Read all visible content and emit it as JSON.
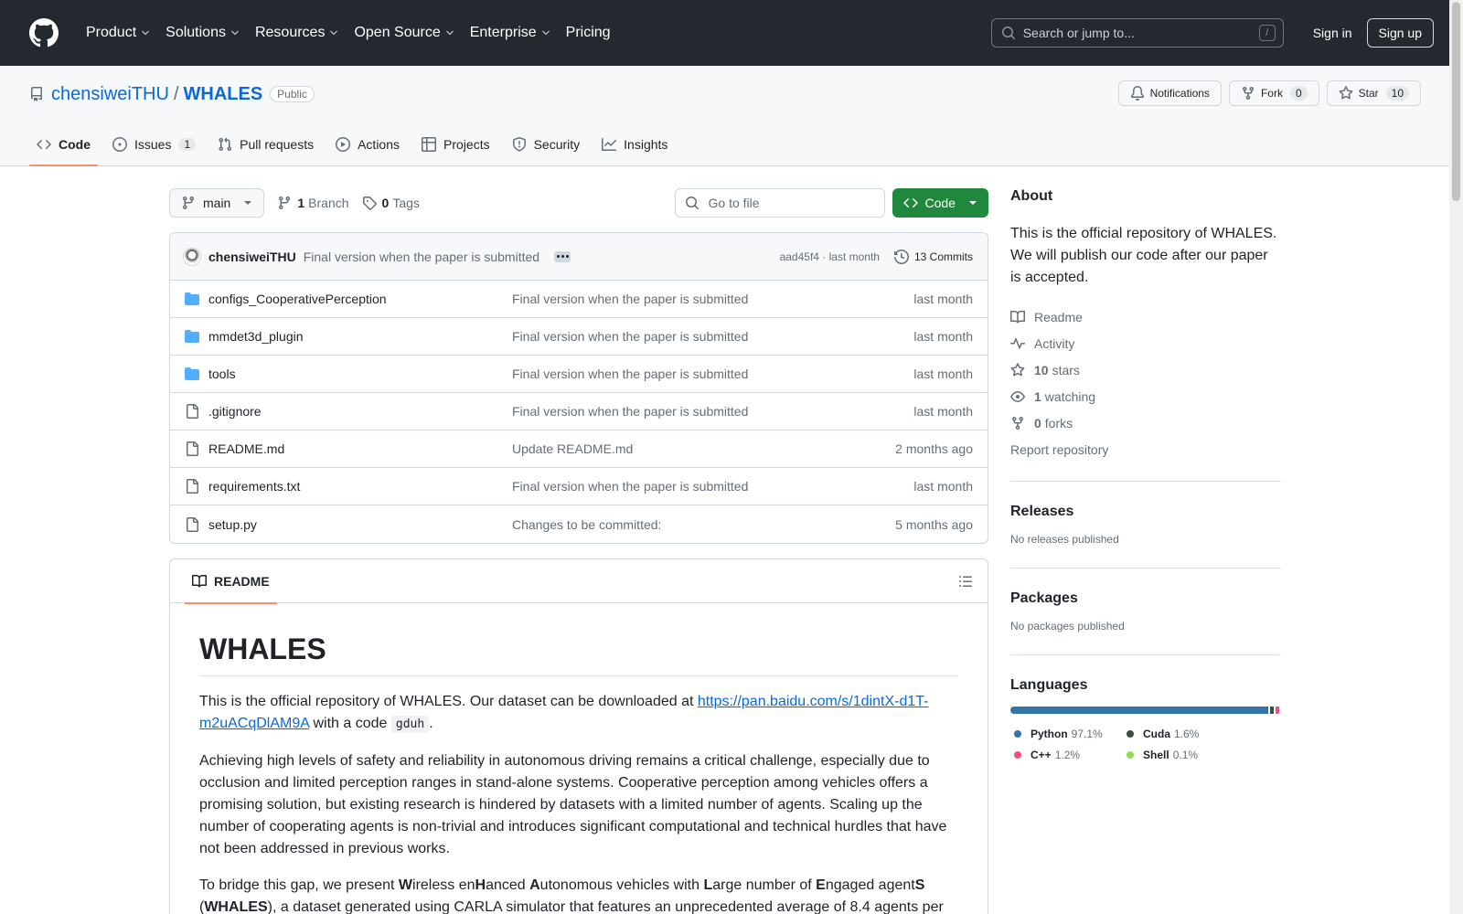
{
  "header": {
    "nav": [
      {
        "label": "Product",
        "dropdown": true
      },
      {
        "label": "Solutions",
        "dropdown": true
      },
      {
        "label": "Resources",
        "dropdown": true
      },
      {
        "label": "Open Source",
        "dropdown": true
      },
      {
        "label": "Enterprise",
        "dropdown": true
      },
      {
        "label": "Pricing",
        "dropdown": false
      }
    ],
    "search_placeholder": "Search or jump to...",
    "search_shortcut": "/",
    "signin_label": "Sign in",
    "signup_label": "Sign up"
  },
  "repo": {
    "owner": "chensiweiTHU",
    "separator": "/",
    "name": "WHALES",
    "visibility": "Public",
    "notifications_label": "Notifications",
    "fork_label": "Fork",
    "fork_count": "0",
    "star_label": "Star",
    "star_count": "10",
    "tabs": [
      {
        "label": "Code",
        "icon": "code-icon",
        "active": true,
        "count": ""
      },
      {
        "label": "Issues",
        "icon": "issue-icon",
        "active": false,
        "count": "1"
      },
      {
        "label": "Pull requests",
        "icon": "pull-request-icon",
        "active": false,
        "count": ""
      },
      {
        "label": "Actions",
        "icon": "play-icon",
        "active": false,
        "count": ""
      },
      {
        "label": "Projects",
        "icon": "table-icon",
        "active": false,
        "count": ""
      },
      {
        "label": "Security",
        "icon": "shield-icon",
        "active": false,
        "count": ""
      },
      {
        "label": "Insights",
        "icon": "graph-icon",
        "active": false,
        "count": ""
      }
    ]
  },
  "filebar": {
    "branch": "main",
    "branches_count": "1",
    "branches_label": "Branch",
    "tags_count": "0",
    "tags_label": "Tags",
    "goto_placeholder": "Go to file",
    "code_label": "Code"
  },
  "commit": {
    "author": "chensiweiTHU",
    "message": "Final version when the paper is submitted",
    "sha_time": "aad45f4 · last month",
    "commits_label": "13 Commits"
  },
  "files": [
    {
      "type": "folder",
      "name": "configs_CooperativePerception",
      "message": "Final version when the paper is submitted",
      "date": "last month"
    },
    {
      "type": "folder",
      "name": "mmdet3d_plugin",
      "message": "Final version when the paper is submitted",
      "date": "last month"
    },
    {
      "type": "folder",
      "name": "tools",
      "message": "Final version when the paper is submitted",
      "date": "last month"
    },
    {
      "type": "file",
      "name": ".gitignore",
      "message": "Final version when the paper is submitted",
      "date": "last month"
    },
    {
      "type": "file",
      "name": "README.md",
      "message": "Update README.md",
      "date": "2 months ago"
    },
    {
      "type": "file",
      "name": "requirements.txt",
      "message": "Final version when the paper is submitted",
      "date": "last month"
    },
    {
      "type": "file",
      "name": "setup.py",
      "message": "Changes to be committed:",
      "date": "5 months ago"
    }
  ],
  "readme": {
    "tab_label": "README",
    "title": "WHALES",
    "p1_before": "This is the official repository of WHALES. Our dataset can be downloaded at ",
    "p1_link": "https://pan.baidu.com/s/1dintX-d1T-m2uACqDlAM9A",
    "p1_mid": " with a code ",
    "p1_code": "gduh",
    "p1_end": ".",
    "p2": "Achieving high levels of safety and reliability in autonomous driving remains a critical challenge, especially due to occlusion and limited perception ranges in stand-alone systems. Cooperative perception among vehicles offers a promising solution, but existing research is hindered by datasets with a limited number of agents. Scaling up the number of cooperating agents is non-trivial and introduces significant computational and technical hurdles that have not been addressed in previous works.",
    "p3_parts": [
      "To bridge this gap, we present ",
      "W",
      "ireless en",
      "H",
      "anced ",
      "A",
      "utonomous vehicles with ",
      "L",
      "arge number of ",
      "E",
      "ngaged agent",
      "S",
      " (",
      "WHALES",
      "), a dataset generated using CARLA simulator that features an unprecedented average of 8.4 agents per"
    ]
  },
  "about": {
    "title": "About",
    "description": "This is the official repository of WHALES. We will publish our code after our paper is accepted.",
    "readme_label": "Readme",
    "activity_label": "Activity",
    "stars_count": "10",
    "stars_label": "stars",
    "watching_count": "1",
    "watching_label": "watching",
    "forks_count": "0",
    "forks_label": "forks",
    "report_label": "Report repository"
  },
  "releases": {
    "title": "Releases",
    "empty": "No releases published"
  },
  "packages": {
    "title": "Packages",
    "empty": "No packages published"
  },
  "languages": {
    "title": "Languages",
    "items": [
      {
        "name": "Python",
        "pct": "97.1%",
        "value": 97.1,
        "color": "#3572A5"
      },
      {
        "name": "Cuda",
        "pct": "1.6%",
        "value": 1.6,
        "color": "#3A4E3A"
      },
      {
        "name": "C++",
        "pct": "1.2%",
        "value": 1.2,
        "color": "#f34b7d"
      },
      {
        "name": "Shell",
        "pct": "0.1%",
        "value": 0.1,
        "color": "#89e051"
      }
    ]
  }
}
